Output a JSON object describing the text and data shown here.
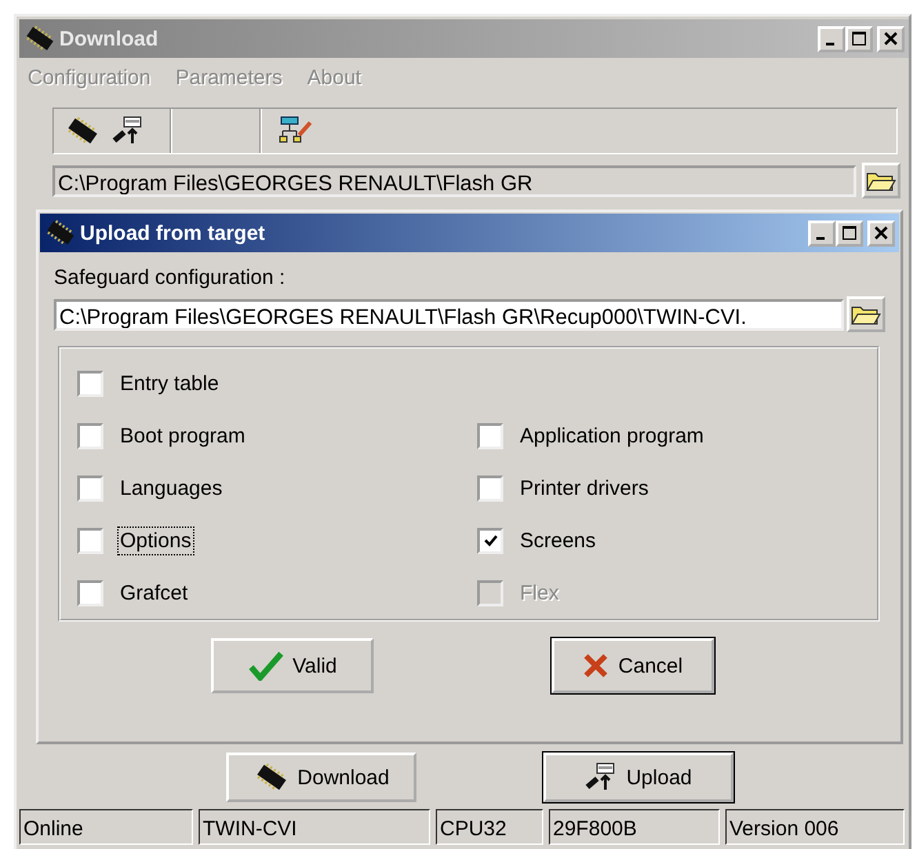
{
  "window": {
    "title": "Download"
  },
  "menu": [
    {
      "label": "Configuration",
      "disabled": true
    },
    {
      "label": "Parameters",
      "disabled": true
    },
    {
      "label": "About",
      "disabled": true
    }
  ],
  "path_field": {
    "value": "C:\\Program Files\\GEORGES RENAULT\\Flash GR"
  },
  "dialog": {
    "title": "Upload from target",
    "field_label": "Safeguard configuration :",
    "field_value": "C:\\Program Files\\GEORGES RENAULT\\Flash GR\\Recup000\\TWIN-CVI.",
    "option_rows": [
      [
        {
          "label": "Entry table",
          "checked": false,
          "disabled": false,
          "focused": false
        }
      ],
      [
        {
          "label": "Boot program",
          "checked": false,
          "disabled": false,
          "focused": false
        },
        {
          "label": "Application program",
          "checked": false,
          "disabled": false,
          "focused": false
        }
      ],
      [
        {
          "label": "Languages",
          "checked": false,
          "disabled": false,
          "focused": false
        },
        {
          "label": "Printer drivers",
          "checked": false,
          "disabled": false,
          "focused": false
        }
      ],
      [
        {
          "label": "Options",
          "checked": false,
          "disabled": false,
          "focused": true
        },
        {
          "label": "Screens",
          "checked": true,
          "disabled": false,
          "focused": false
        }
      ],
      [
        {
          "label": "Grafcet",
          "checked": false,
          "disabled": false,
          "focused": false
        },
        {
          "label": "Flex",
          "checked": false,
          "disabled": true,
          "focused": false
        }
      ]
    ],
    "buttons": [
      {
        "label": "Valid",
        "kind": "check",
        "default": false
      },
      {
        "label": "Cancel",
        "kind": "cross",
        "default": true
      }
    ]
  },
  "main_buttons": [
    {
      "label": "Download",
      "kind": "chip",
      "default": false
    },
    {
      "label": "Upload",
      "kind": "upload",
      "default": true
    }
  ],
  "status_bar": [
    "Online",
    "TWIN-CVI",
    "CPU32",
    "29F800B",
    "Version 006"
  ]
}
